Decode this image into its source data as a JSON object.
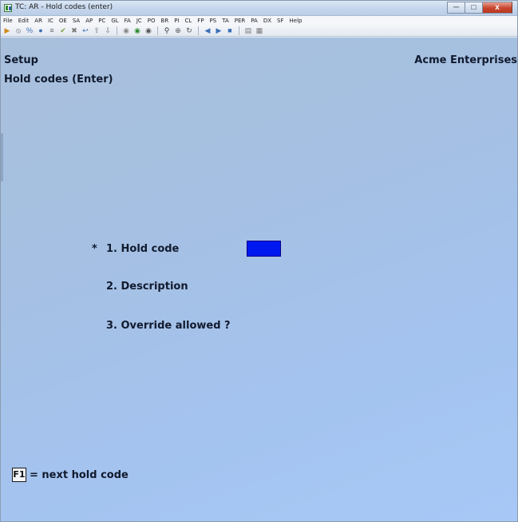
{
  "window": {
    "title": "TC: AR - Hold codes (enter)",
    "controls": {
      "minimize": "─",
      "maximize": "□",
      "close": "x"
    }
  },
  "menu": [
    "File",
    "Edit",
    "AR",
    "IC",
    "OE",
    "SA",
    "AP",
    "PC",
    "GL",
    "FA",
    "JC",
    "PO",
    "BR",
    "PI",
    "CL",
    "FP",
    "PS",
    "TA",
    "PER",
    "PA",
    "DX",
    "SF",
    "Help"
  ],
  "toolbar": {
    "groups": [
      [
        {
          "icon": "play-icon",
          "glyph": "▶",
          "color": "#d28a1a"
        },
        {
          "icon": "stop-icon",
          "glyph": "⦸",
          "color": "#555555"
        },
        {
          "icon": "percent-icon",
          "glyph": "%",
          "color": "#3a6fb5"
        },
        {
          "icon": "record-icon",
          "glyph": "●",
          "color": "#3a6fb5"
        },
        {
          "icon": "equals-icon",
          "glyph": "≡",
          "color": "#666666"
        },
        {
          "icon": "check-icon",
          "glyph": "✔",
          "color": "#7a9a3a"
        },
        {
          "icon": "cancel-x-icon",
          "glyph": "✖",
          "color": "#777777"
        },
        {
          "icon": "undo-icon",
          "glyph": "↩",
          "color": "#3a6fb5"
        },
        {
          "icon": "arrow-up-icon",
          "glyph": "⇧",
          "color": "#777777"
        },
        {
          "icon": "arrow-down-icon",
          "glyph": "⇩",
          "color": "#777777"
        }
      ],
      [
        {
          "icon": "circle-icon",
          "glyph": "◉",
          "color": "#888888"
        },
        {
          "icon": "circle-green-icon",
          "glyph": "◉",
          "color": "#2e8b2e"
        },
        {
          "icon": "circle-dark-icon",
          "glyph": "◉",
          "color": "#555555"
        }
      ],
      [
        {
          "icon": "binoculars-icon",
          "glyph": "⚲",
          "color": "#333333"
        },
        {
          "icon": "zoom-icon",
          "glyph": "⊕",
          "color": "#555555"
        },
        {
          "icon": "refresh-icon",
          "glyph": "↻",
          "color": "#555555"
        }
      ],
      [
        {
          "icon": "prev-icon",
          "glyph": "◀",
          "color": "#3a6fb5"
        },
        {
          "icon": "next-icon",
          "glyph": "▶",
          "color": "#3a6fb5"
        },
        {
          "icon": "stop-record-icon",
          "glyph": "■",
          "color": "#3a6fb5"
        }
      ],
      [
        {
          "icon": "print-icon",
          "glyph": "▤",
          "color": "#777777"
        },
        {
          "icon": "calculator-icon",
          "glyph": "▦",
          "color": "#777777"
        }
      ]
    ]
  },
  "screen": {
    "mode": "Setup",
    "company": "Acme Enterprises",
    "title": "Hold codes (Enter)",
    "required_marker": "*",
    "fields": [
      {
        "label": "1. Hold code",
        "value": ""
      },
      {
        "label": "2. Description"
      },
      {
        "label": "3. Override allowed ?"
      }
    ],
    "fkey": {
      "key": "F1",
      "text": "= next hold code"
    }
  },
  "colors": {
    "screen_background": "#a5c2ea",
    "input_highlight": "#0018f0",
    "text": "#111a2e"
  }
}
